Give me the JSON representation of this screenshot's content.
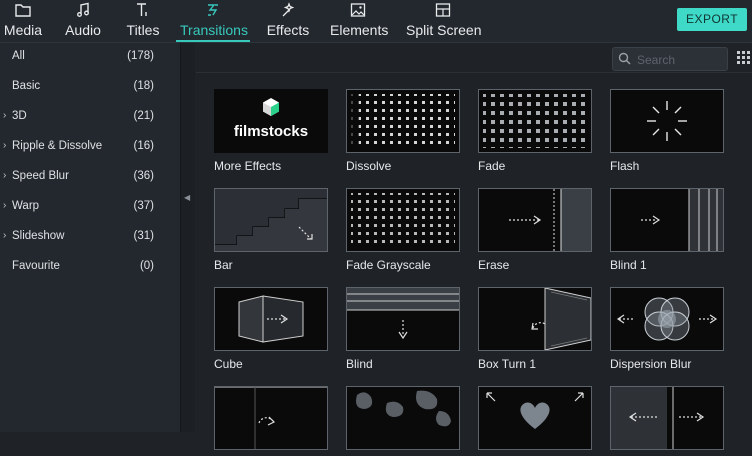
{
  "toolbar": {
    "tabs": [
      {
        "label": "Media",
        "icon": "folder-icon"
      },
      {
        "label": "Audio",
        "icon": "music-note-icon"
      },
      {
        "label": "Titles",
        "icon": "text-icon"
      },
      {
        "label": "Transitions",
        "icon": "transition-icon"
      },
      {
        "label": "Effects",
        "icon": "sparkle-icon"
      },
      {
        "label": "Elements",
        "icon": "image-icon"
      },
      {
        "label": "Split Screen",
        "icon": "split-screen-icon"
      }
    ],
    "active_tab": "Transitions",
    "export_label": "EXPORT"
  },
  "sidebar": {
    "categories": [
      {
        "label": "All",
        "count": "(178)",
        "expandable": false
      },
      {
        "label": "Basic",
        "count": "(18)",
        "expandable": false
      },
      {
        "label": "3D",
        "count": "(21)",
        "expandable": true
      },
      {
        "label": "Ripple & Dissolve",
        "count": "(16)",
        "expandable": true
      },
      {
        "label": "Speed Blur",
        "count": "(36)",
        "expandable": true
      },
      {
        "label": "Warp",
        "count": "(37)",
        "expandable": true
      },
      {
        "label": "Slideshow",
        "count": "(31)",
        "expandable": true
      },
      {
        "label": "Favourite",
        "count": "(0)",
        "expandable": false
      }
    ],
    "selected": "All"
  },
  "search": {
    "placeholder": "Search",
    "value": ""
  },
  "transitions": [
    {
      "label": "More Effects",
      "thumb": "filmstocks",
      "brand_text": "filmstocks"
    },
    {
      "label": "Dissolve",
      "thumb": "dissolve"
    },
    {
      "label": "Fade",
      "thumb": "fade"
    },
    {
      "label": "Flash",
      "thumb": "flash"
    },
    {
      "label": "Bar",
      "thumb": "bar"
    },
    {
      "label": "Fade Grayscale",
      "thumb": "fade-grayscale"
    },
    {
      "label": "Erase",
      "thumb": "erase"
    },
    {
      "label": "Blind 1",
      "thumb": "blind1"
    },
    {
      "label": "Cube",
      "thumb": "cube"
    },
    {
      "label": "Blind",
      "thumb": "blind"
    },
    {
      "label": "Box Turn 1",
      "thumb": "boxturn"
    },
    {
      "label": "Dispersion Blur",
      "thumb": "dispersion"
    },
    {
      "label": "",
      "thumb": "partial-arc"
    },
    {
      "label": "",
      "thumb": "partial-blobs"
    },
    {
      "label": "",
      "thumb": "partial-heart"
    },
    {
      "label": "",
      "thumb": "partial-arrows"
    }
  ],
  "colors": {
    "accent": "#38c9bd",
    "export_bg": "#3fd9c8",
    "sidebar_bg": "#23282e",
    "main_bg": "#1f2328"
  }
}
